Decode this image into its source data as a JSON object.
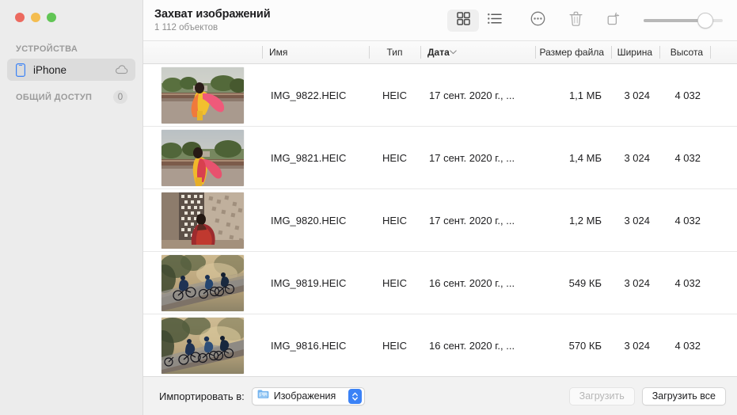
{
  "window": {
    "title": "Захват изображений",
    "subtitle": "1 112 объектов",
    "traffic_lights": {
      "close": "close-button",
      "minimize": "minimize-button",
      "zoom": "zoom-button"
    }
  },
  "sidebar": {
    "devices_header": "УСТРОЙСТВА",
    "devices": [
      {
        "label": "iPhone",
        "icon": "iphone-icon",
        "trailing_icon": "cloud-icon",
        "selected": true
      }
    ],
    "shared_header": "ОБЩИЙ ДОСТУП",
    "shared_count": "0"
  },
  "toolbar": {
    "buttons": [
      {
        "name": "grid-view-button",
        "icon": "grid-icon",
        "active": true
      },
      {
        "name": "list-view-button",
        "icon": "list-icon",
        "active": false
      },
      {
        "name": "more-options-button",
        "icon": "ellipsis-circle-icon",
        "active": false
      },
      {
        "name": "delete-button",
        "icon": "trash-icon",
        "active": false
      },
      {
        "name": "rotate-button",
        "icon": "rotate-icon",
        "active": false
      }
    ],
    "zoom_slider": {
      "name": "thumbnail-size-slider",
      "value": 85
    }
  },
  "table": {
    "columns": [
      {
        "key": "thumbnail",
        "label": "",
        "align": "center"
      },
      {
        "key": "name",
        "label": "Имя",
        "align": "left"
      },
      {
        "key": "type",
        "label": "Тип",
        "align": "center"
      },
      {
        "key": "date",
        "label": "Дата",
        "align": "left",
        "sorted": true
      },
      {
        "key": "size",
        "label": "Размер файла",
        "align": "right"
      },
      {
        "key": "width",
        "label": "Ширина",
        "align": "right"
      },
      {
        "key": "height",
        "label": "Высота",
        "align": "right"
      }
    ],
    "rows": [
      {
        "name": "IMG_9822.HEIC",
        "type": "HEIC",
        "date": "17 сент. 2020 г., ...",
        "size": "1,1 МБ",
        "width": "3 024",
        "height": "4 032",
        "thumb": "sari-terrace-a"
      },
      {
        "name": "IMG_9821.HEIC",
        "type": "HEIC",
        "date": "17 сент. 2020 г., ...",
        "size": "1,4 МБ",
        "width": "3 024",
        "height": "4 032",
        "thumb": "sari-terrace-b"
      },
      {
        "name": "IMG_9820.HEIC",
        "type": "HEIC",
        "date": "17 сент. 2020 г., ...",
        "size": "1,2 МБ",
        "width": "3 024",
        "height": "4 032",
        "thumb": "sari-lattice"
      },
      {
        "name": "IMG_9819.HEIC",
        "type": "HEIC",
        "date": "16 сент. 2020 г., ...",
        "size": "549 КБ",
        "width": "3 024",
        "height": "4 032",
        "thumb": "cyclists-a"
      },
      {
        "name": "IMG_9816.HEIC",
        "type": "HEIC",
        "date": "16 сент. 2020 г., ...",
        "size": "570 КБ",
        "width": "3 024",
        "height": "4 032",
        "thumb": "cyclists-b"
      }
    ]
  },
  "bottom_bar": {
    "import_label": "Импортировать в:",
    "import_destination": "Изображения",
    "download_button": "Загрузить",
    "download_all_button": "Загрузить все"
  },
  "colors": {
    "accent": "#3b82f6",
    "sidebar_bg": "#ececec",
    "selected_row_bg": "#dcdcdc"
  }
}
